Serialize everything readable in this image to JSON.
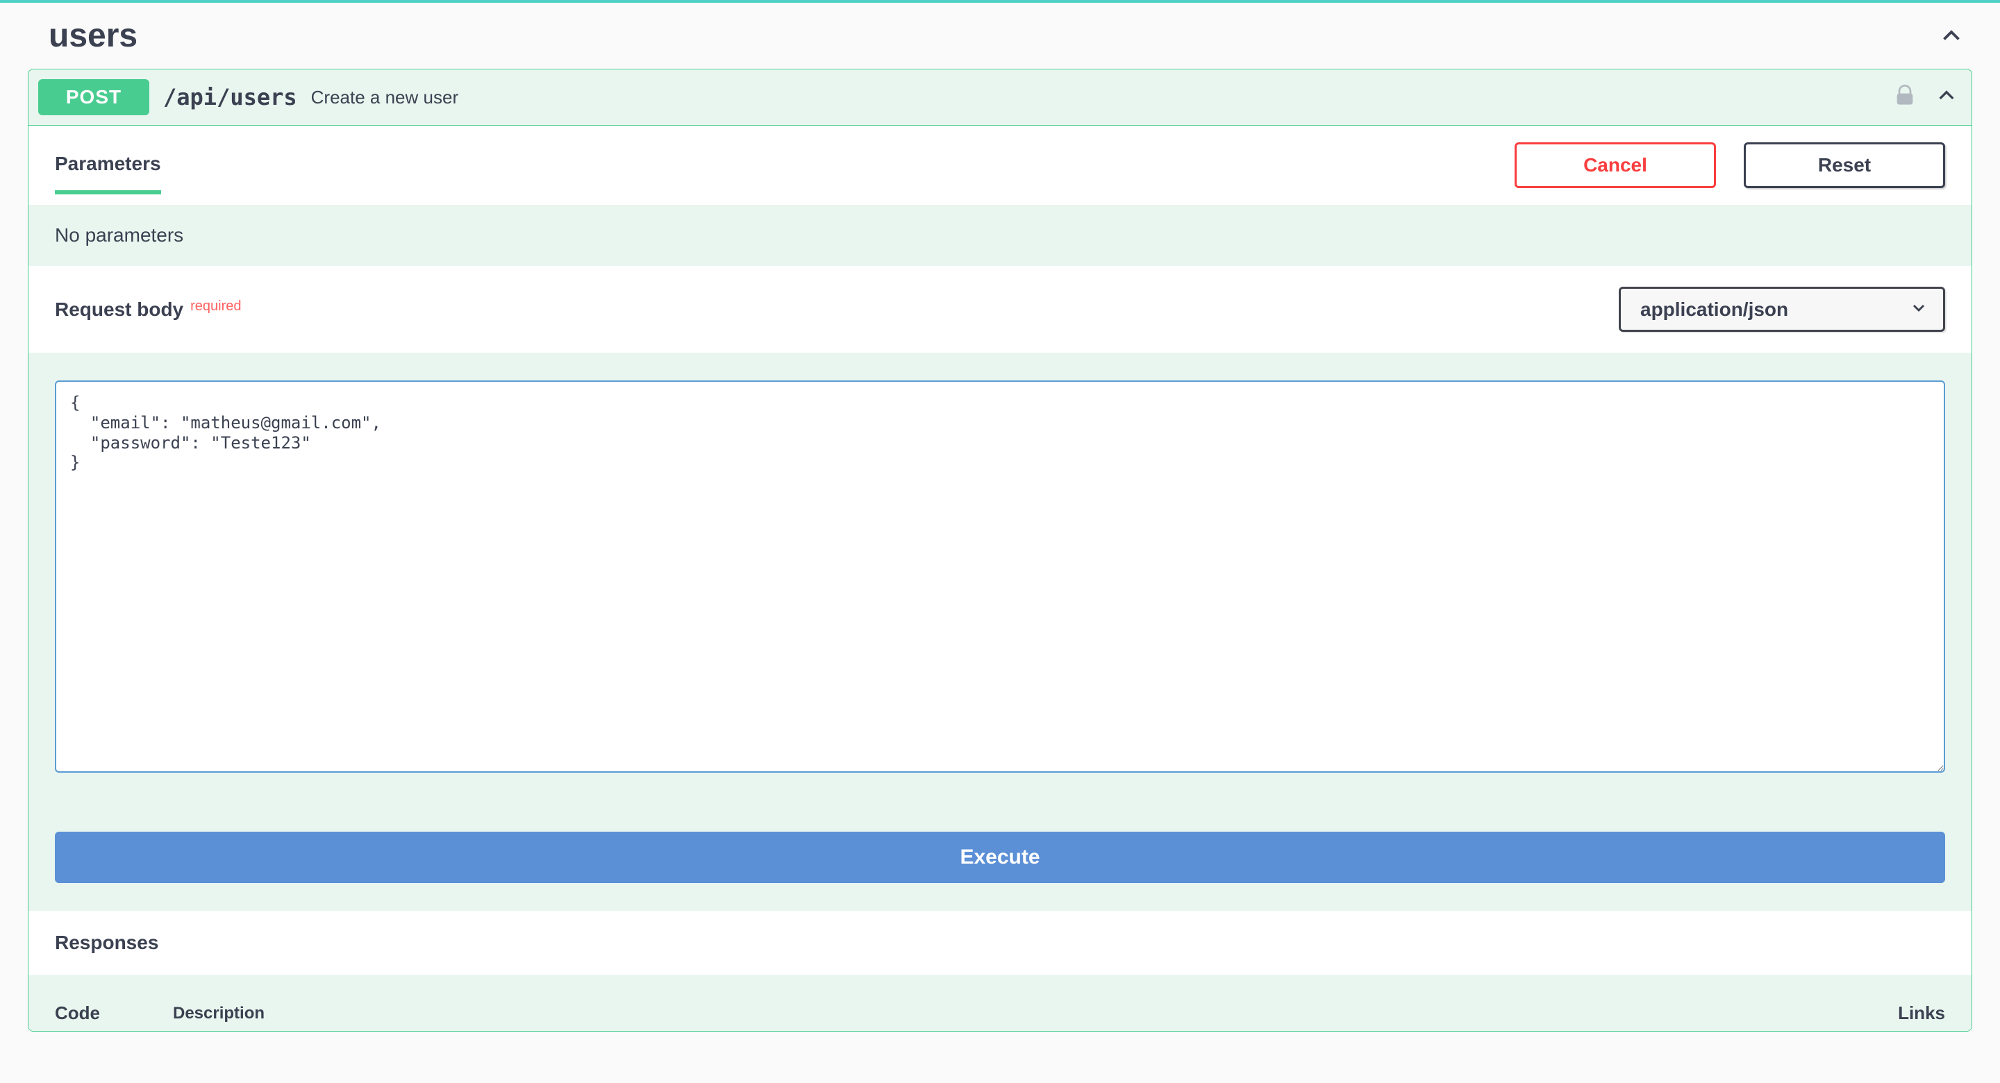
{
  "tag": {
    "name": "users"
  },
  "operation": {
    "method": "POST",
    "path": "/api/users",
    "summary": "Create a new user"
  },
  "parameters": {
    "tab_label": "Parameters",
    "cancel_label": "Cancel",
    "reset_label": "Reset",
    "no_params_text": "No parameters"
  },
  "request_body": {
    "title": "Request body",
    "required_label": "required",
    "content_type": "application/json",
    "value": "{\n  \"email\": \"matheus@gmail.com\",\n  \"password\": \"Teste123\"\n}"
  },
  "execute": {
    "label": "Execute"
  },
  "responses": {
    "title": "Responses",
    "columns": {
      "code": "Code",
      "description": "Description",
      "links": "Links"
    }
  }
}
